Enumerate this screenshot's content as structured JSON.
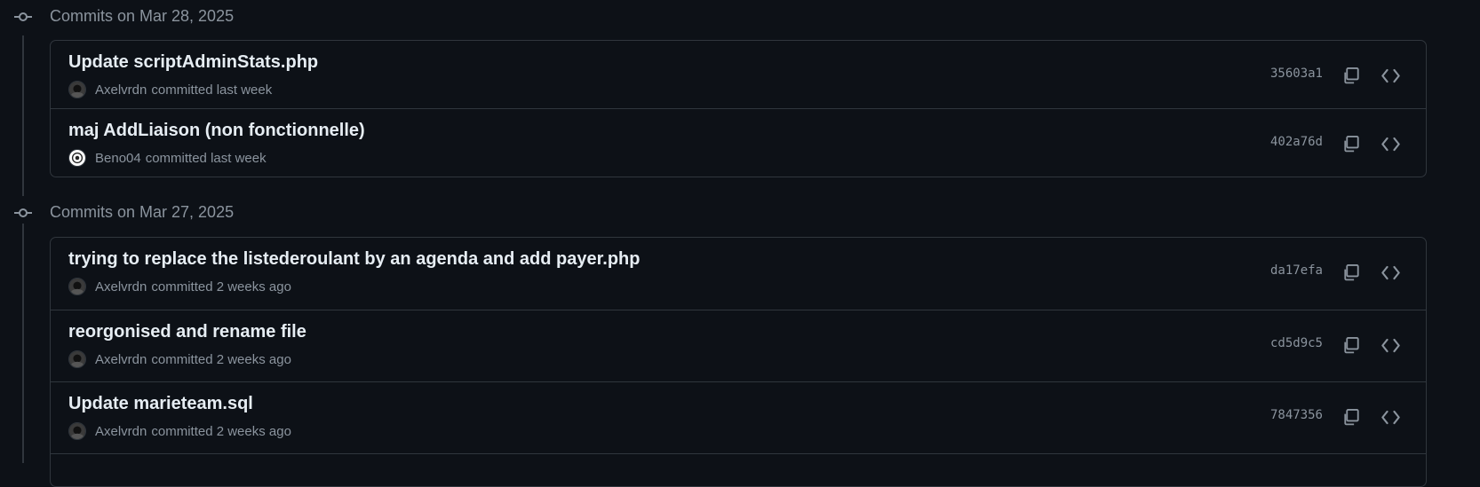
{
  "groups": [
    {
      "date_label": "Commits on Mar 28, 2025",
      "commits": [
        {
          "title": "Update scriptAdminStats.php",
          "author": "Axelvrdn",
          "action": "committed last week",
          "hash": "35603a1",
          "avatar": "avatar-axelvrdn"
        },
        {
          "title": "maj AddLiaison (non fonctionnelle)",
          "author": "Beno04",
          "action": "committed last week",
          "hash": "402a76d",
          "avatar": "avatar-beno04"
        }
      ]
    },
    {
      "date_label": "Commits on Mar 27, 2025",
      "commits": [
        {
          "title": "trying to replace the listederoulant by an agenda and add payer.php",
          "author": "Axelvrdn",
          "action": "committed 2 weeks ago",
          "hash": "da17efa",
          "avatar": "avatar-axelvrdn"
        },
        {
          "title": "reorgonised and rename file",
          "author": "Axelvrdn",
          "action": "committed 2 weeks ago",
          "hash": "cd5d9c5",
          "avatar": "avatar-axelvrdn"
        },
        {
          "title": "Update marieteam.sql",
          "author": "Axelvrdn",
          "action": "committed 2 weeks ago",
          "hash": "7847356",
          "avatar": "avatar-axelvrdn"
        }
      ]
    }
  ],
  "colors": {
    "background": "#0d1117",
    "border": "#30363d",
    "text": "#e6edf3",
    "muted": "#8b949e"
  },
  "icons": {
    "commit_node": "git-commit-icon",
    "copy": "copy-icon",
    "browse": "code-icon"
  }
}
